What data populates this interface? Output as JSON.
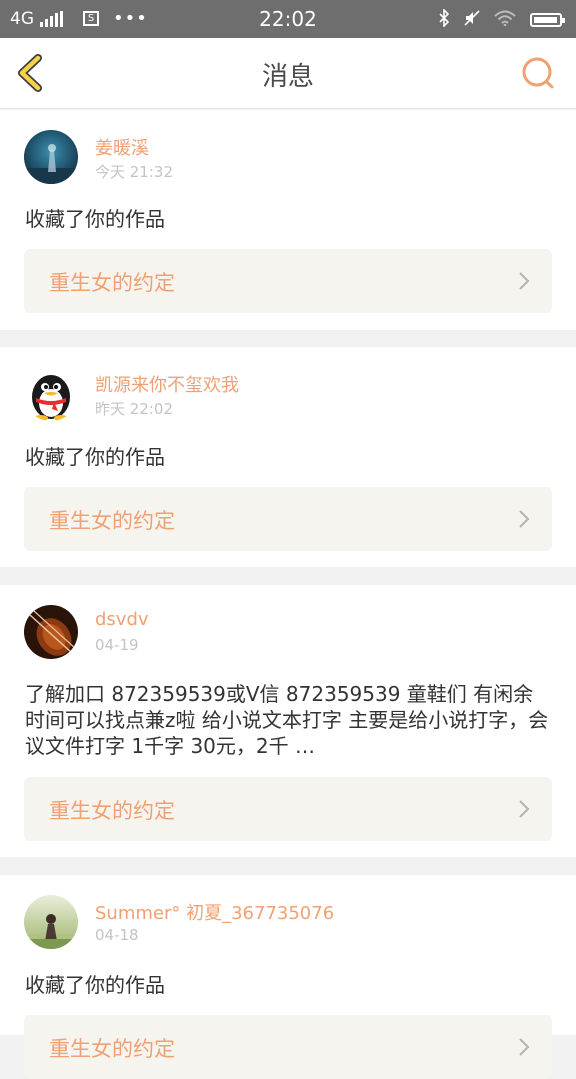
{
  "status": {
    "network": "4G",
    "sim": "S",
    "dots": "•••",
    "time": "22:02",
    "battery_level": 0.95
  },
  "header": {
    "title": "消息"
  },
  "messages": [
    {
      "name": "姜暖溪",
      "time": "今天 21:32",
      "text": "收藏了你的作品",
      "work": "重生女的约定"
    },
    {
      "name": "凯源来你不玺欢我",
      "time": "昨天 22:02",
      "text": "收藏了你的作品",
      "work": "重生女的约定"
    },
    {
      "name": "dsvdv",
      "time": "04-19",
      "text": "了解加口 872359539或V信 872359539 童鞋们 有闲余时间可以找点兼z啦 给小说文本打字 主要是给小说打字，会议文件打字 1千字 30元，2千 …",
      "work": "重生女的约定"
    },
    {
      "name": "Summer° 初夏_367735076",
      "time": "04-18",
      "text": "收藏了你的作品",
      "work": "重生女的约定"
    }
  ],
  "colors": {
    "accent": "#f0a173",
    "back_icon": "#f5d24a",
    "card_box": "#f6f4ee"
  }
}
